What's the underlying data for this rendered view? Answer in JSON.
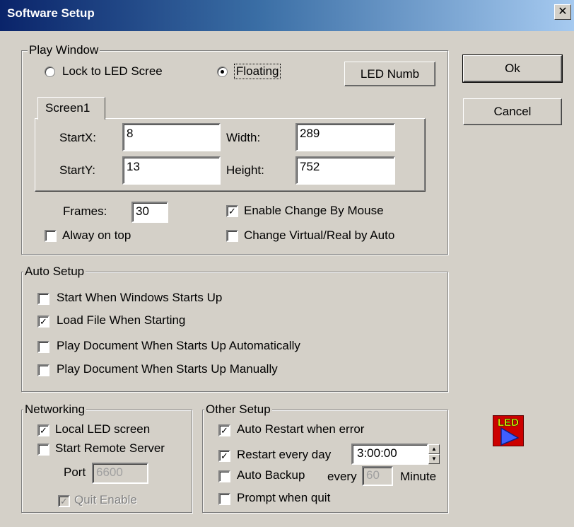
{
  "window": {
    "title": "Software Setup",
    "close_glyph": "✕"
  },
  "buttons": {
    "ok": "Ok",
    "cancel": "Cancel",
    "led_numb": "LED Numb"
  },
  "play_window": {
    "label": "Play Window",
    "radio_lock": "Lock to LED Scree",
    "radio_floating": "Floating",
    "radio_selected": "floating",
    "tab_label": "Screen1",
    "startx_label": "StartX:",
    "startx_value": "8",
    "starty_label": "StartY:",
    "starty_value": "13",
    "width_label": "Width:",
    "width_value": "289",
    "height_label": "Height:",
    "height_value": "752",
    "frames_label": "Frames:",
    "frames_value": "30",
    "always_on_top": {
      "label": "Alway on top",
      "checked": false
    },
    "enable_change_mouse": {
      "label": "Enable Change By Mouse",
      "checked": true
    },
    "change_virtual_real": {
      "label": "Change Virtual/Real by Auto",
      "checked": false
    }
  },
  "auto_setup": {
    "label": "Auto Setup",
    "items": [
      {
        "label": "Start When Windows Starts Up",
        "checked": false
      },
      {
        "label": "Load File When Starting",
        "checked": true
      },
      {
        "label": "Play Document When Starts Up Automatically",
        "checked": false
      },
      {
        "label": "Play Document When Starts Up Manually",
        "checked": false
      }
    ]
  },
  "networking": {
    "label": "Networking",
    "local_led": {
      "label": "Local LED screen",
      "checked": true
    },
    "remote_server": {
      "label": "Start Remote Server",
      "checked": false
    },
    "port_label": "Port",
    "port_value": "6600",
    "quit_enable": {
      "label": "Quit Enable",
      "checked": true,
      "disabled": true
    }
  },
  "other_setup": {
    "label": "Other Setup",
    "auto_restart": {
      "label": "Auto Restart when error",
      "checked": true
    },
    "restart_every_day": {
      "label": "Restart every day",
      "checked": true
    },
    "restart_time": "3:00:00",
    "auto_backup": {
      "label": "Auto Backup",
      "checked": false
    },
    "every_label": "every",
    "backup_value": "60",
    "minute_label": "Minute",
    "prompt_quit": {
      "label": "Prompt when quit",
      "checked": false
    }
  },
  "logo": {
    "text": "LED",
    "icon": "led-play-logo"
  },
  "colors": {
    "face": "#d4d0c8",
    "title_start": "#0a246a",
    "title_end": "#a6caf0",
    "logo_bg": "#d40000"
  }
}
